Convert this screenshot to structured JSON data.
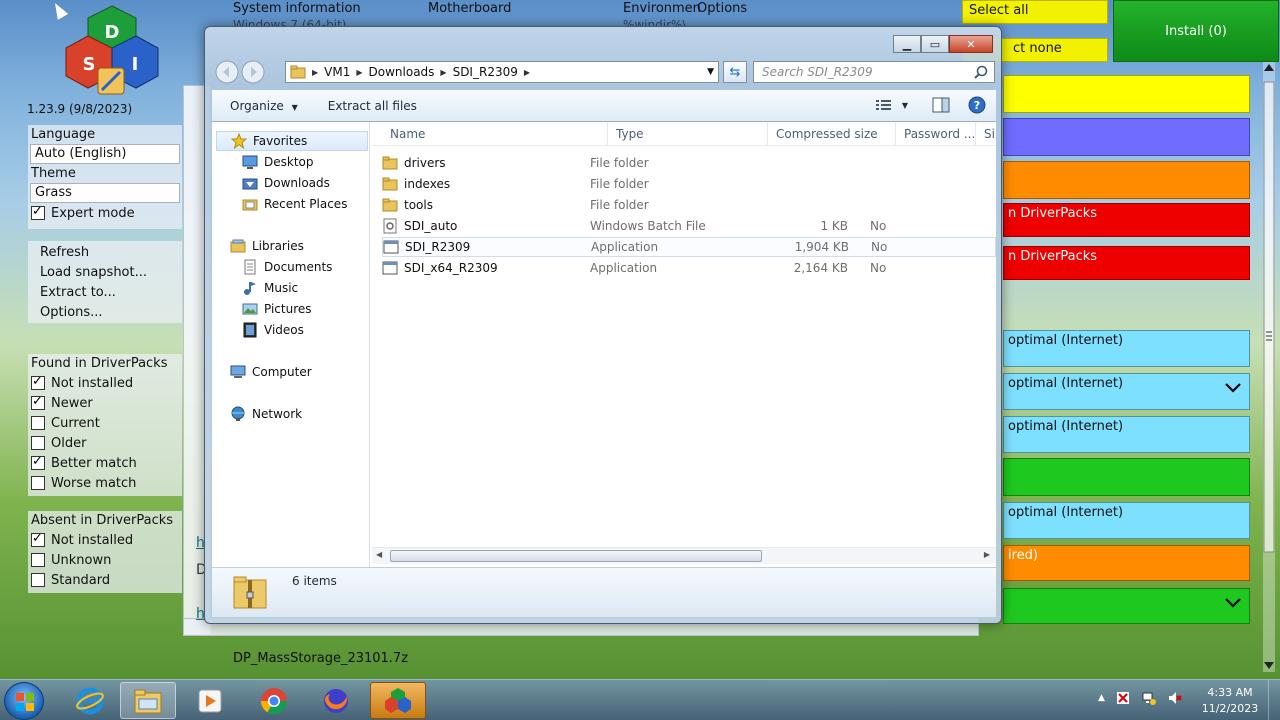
{
  "sdi": {
    "version": "1.23.9 (9/8/2023)",
    "topbar": {
      "system_info": "System information",
      "system_info_sub": "Windows 7 (64-bit)",
      "motherboard": "Motherboard",
      "environment": "Environmen",
      "environment_sub": "%windir%\\",
      "options": "Options"
    },
    "language_label": "Language",
    "language_value": "Auto (English)",
    "theme_label": "Theme",
    "theme_value": "Grass",
    "expert_mode": "Expert mode",
    "actions": [
      "Refresh",
      "Load snapshot...",
      "Extract to...",
      "Options..."
    ],
    "found_header": "Found in DriverPacks",
    "found_items": [
      {
        "label": "Not installed",
        "checked": true
      },
      {
        "label": "Newer",
        "checked": true
      },
      {
        "label": "Current",
        "checked": false
      },
      {
        "label": "Older",
        "checked": false
      },
      {
        "label": "Better match",
        "checked": true
      },
      {
        "label": "Worse match",
        "checked": false
      }
    ],
    "absent_header": "Absent in DriverPacks",
    "absent_items": [
      {
        "label": "Not installed",
        "checked": true
      },
      {
        "label": "Unknown",
        "checked": false
      },
      {
        "label": "Standard",
        "checked": false
      }
    ],
    "select_all": "Select all",
    "select_none": "ct none",
    "install": "Install (0)",
    "bands": [
      {
        "text": "",
        "color": "#ffff00"
      },
      {
        "text": "",
        "color": "#6f6cff"
      },
      {
        "text": "",
        "color": "#ff8c00"
      },
      {
        "text": "n DriverPacks",
        "color": "#ee0000"
      },
      {
        "text": "n DriverPacks",
        "color": "#ee0000"
      },
      {
        "text": "optimal (Internet)",
        "color": "#7ee0ff"
      },
      {
        "text": "optimal (Internet)",
        "color": "#7ee0ff"
      },
      {
        "text": "optimal (Internet)",
        "color": "#7ee0ff"
      },
      {
        "text": "",
        "color": "#1ec81e"
      },
      {
        "text": "optimal (Internet)",
        "color": "#7ee0ff"
      },
      {
        "text": "ired)",
        "color": "#ff8c00"
      },
      {
        "text": "",
        "color": "#1ec81e"
      }
    ],
    "bottom_text": "DP_MassStorage_23101.7z",
    "link_frag_1": "h",
    "grey_frag": "D",
    "link_frag_2": "h"
  },
  "explorer": {
    "address": [
      "VM1",
      "Downloads",
      "SDI_R2309"
    ],
    "search_placeholder": "Search SDI_R2309",
    "toolbar": {
      "organize": "Organize",
      "extract_all": "Extract all files"
    },
    "nav": {
      "favorites": "Favorites",
      "favorites_items": [
        "Desktop",
        "Downloads",
        "Recent Places"
      ],
      "libraries": "Libraries",
      "libraries_items": [
        "Documents",
        "Music",
        "Pictures",
        "Videos"
      ],
      "computer": "Computer",
      "network": "Network"
    },
    "columns": [
      "Name",
      "Type",
      "Compressed size",
      "Password ...",
      "Si"
    ],
    "files": [
      {
        "name": "drivers",
        "type": "File folder",
        "size": "",
        "password": "",
        "icon": "folder-icon"
      },
      {
        "name": "indexes",
        "type": "File folder",
        "size": "",
        "password": "",
        "icon": "folder-icon"
      },
      {
        "name": "tools",
        "type": "File folder",
        "size": "",
        "password": "",
        "icon": "folder-icon"
      },
      {
        "name": "SDI_auto",
        "type": "Windows Batch File",
        "size": "1 KB",
        "password": "No",
        "icon": "batch-file-icon"
      },
      {
        "name": "SDI_R2309",
        "type": "Application",
        "size": "1,904 KB",
        "password": "No",
        "icon": "application-icon"
      },
      {
        "name": "SDI_x64_R2309",
        "type": "Application",
        "size": "2,164 KB",
        "password": "No",
        "icon": "application-icon"
      }
    ],
    "item_count": "6 items"
  },
  "taskbar": {
    "time": "4:33 AM",
    "date": "11/2/2023"
  }
}
